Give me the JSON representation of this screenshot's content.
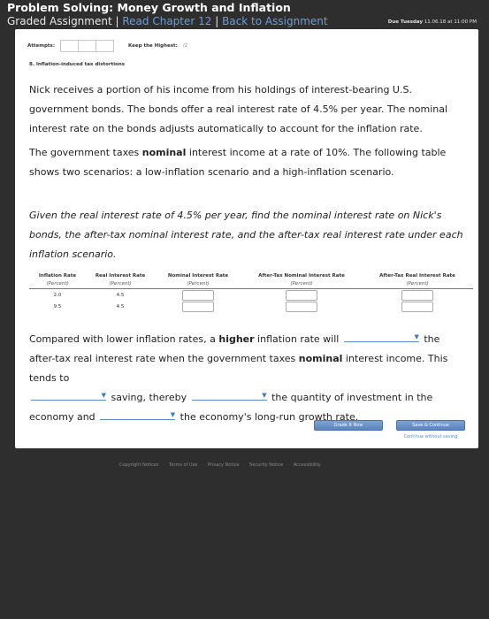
{
  "header": {
    "title": "Problem Solving: Money Growth and Inflation",
    "assignment_type": "Graded Assignment",
    "separator": "|",
    "read_chapter_link": "Read Chapter 12",
    "back_link": "Back to Assignment",
    "due_label": "Due Tuesday",
    "due_date": "11.06.18 at 11:00 PM"
  },
  "attempts": {
    "label": "Attempts:",
    "keep_label": "Keep the Highest:",
    "keep_value": "/2"
  },
  "question": {
    "title": "8. Inflation-induced tax distortions",
    "p1": "Nick receives a portion of his income from his holdings of interest-bearing U.S. government bonds. The bonds offer a real interest rate of 4.5% per year. The nominal interest rate on the bonds adjusts automatically to account for the inflation rate.",
    "p2_pre": "The government taxes ",
    "p2_bold": "nominal",
    "p2_post": " interest income at a rate of 10%. The following table shows two scenarios: a low-inflation scenario and a high-inflation scenario.",
    "p3": "Given the real interest rate of 4.5% per year, find the nominal interest rate on Nick's bonds, the after-tax nominal interest rate, and the after-tax real interest rate under each inflation scenario."
  },
  "table": {
    "headers": [
      "Inflation Rate",
      "Real Interest Rate",
      "Nominal Interest Rate",
      "After-Tax Nominal Interest Rate",
      "After-Tax Real Interest Rate"
    ],
    "units": [
      "(Percent)",
      "(Percent)",
      "(Percent)",
      "(Percent)",
      "(Percent)"
    ],
    "rows": [
      {
        "inflation": "2.0",
        "real": "4.5",
        "nominal": "",
        "after_tax_nominal": "",
        "after_tax_real": ""
      },
      {
        "inflation": "9.5",
        "real": "4.5",
        "nominal": "",
        "after_tax_nominal": "",
        "after_tax_real": ""
      }
    ]
  },
  "fill": {
    "s1": "Compared with lower inflation rates, a ",
    "s1_bold": "higher",
    "s2": " inflation rate will",
    "s3": "the after-tax real interest rate when the government taxes ",
    "s3_bold": "nominal",
    "s4": " interest income. This tends to",
    "s5": "saving, thereby",
    "s6": "the quantity of investment in the economy and",
    "s7": "the economy's long-run growth rate.",
    "dropdowns": [
      "",
      "",
      "",
      ""
    ]
  },
  "buttons": {
    "grade": "Grade It Now",
    "save": "Save & Continue",
    "continue_link": "Continue without saving"
  },
  "footer": {
    "links": [
      "Copyright Notices",
      "Terms of Use",
      "Privacy Notice",
      "Security Notice",
      "Accessibility"
    ],
    "separator": "·"
  },
  "colors": {
    "background": "#2e2e2e",
    "link": "#6a9ed8",
    "button": "#6a93c9"
  }
}
